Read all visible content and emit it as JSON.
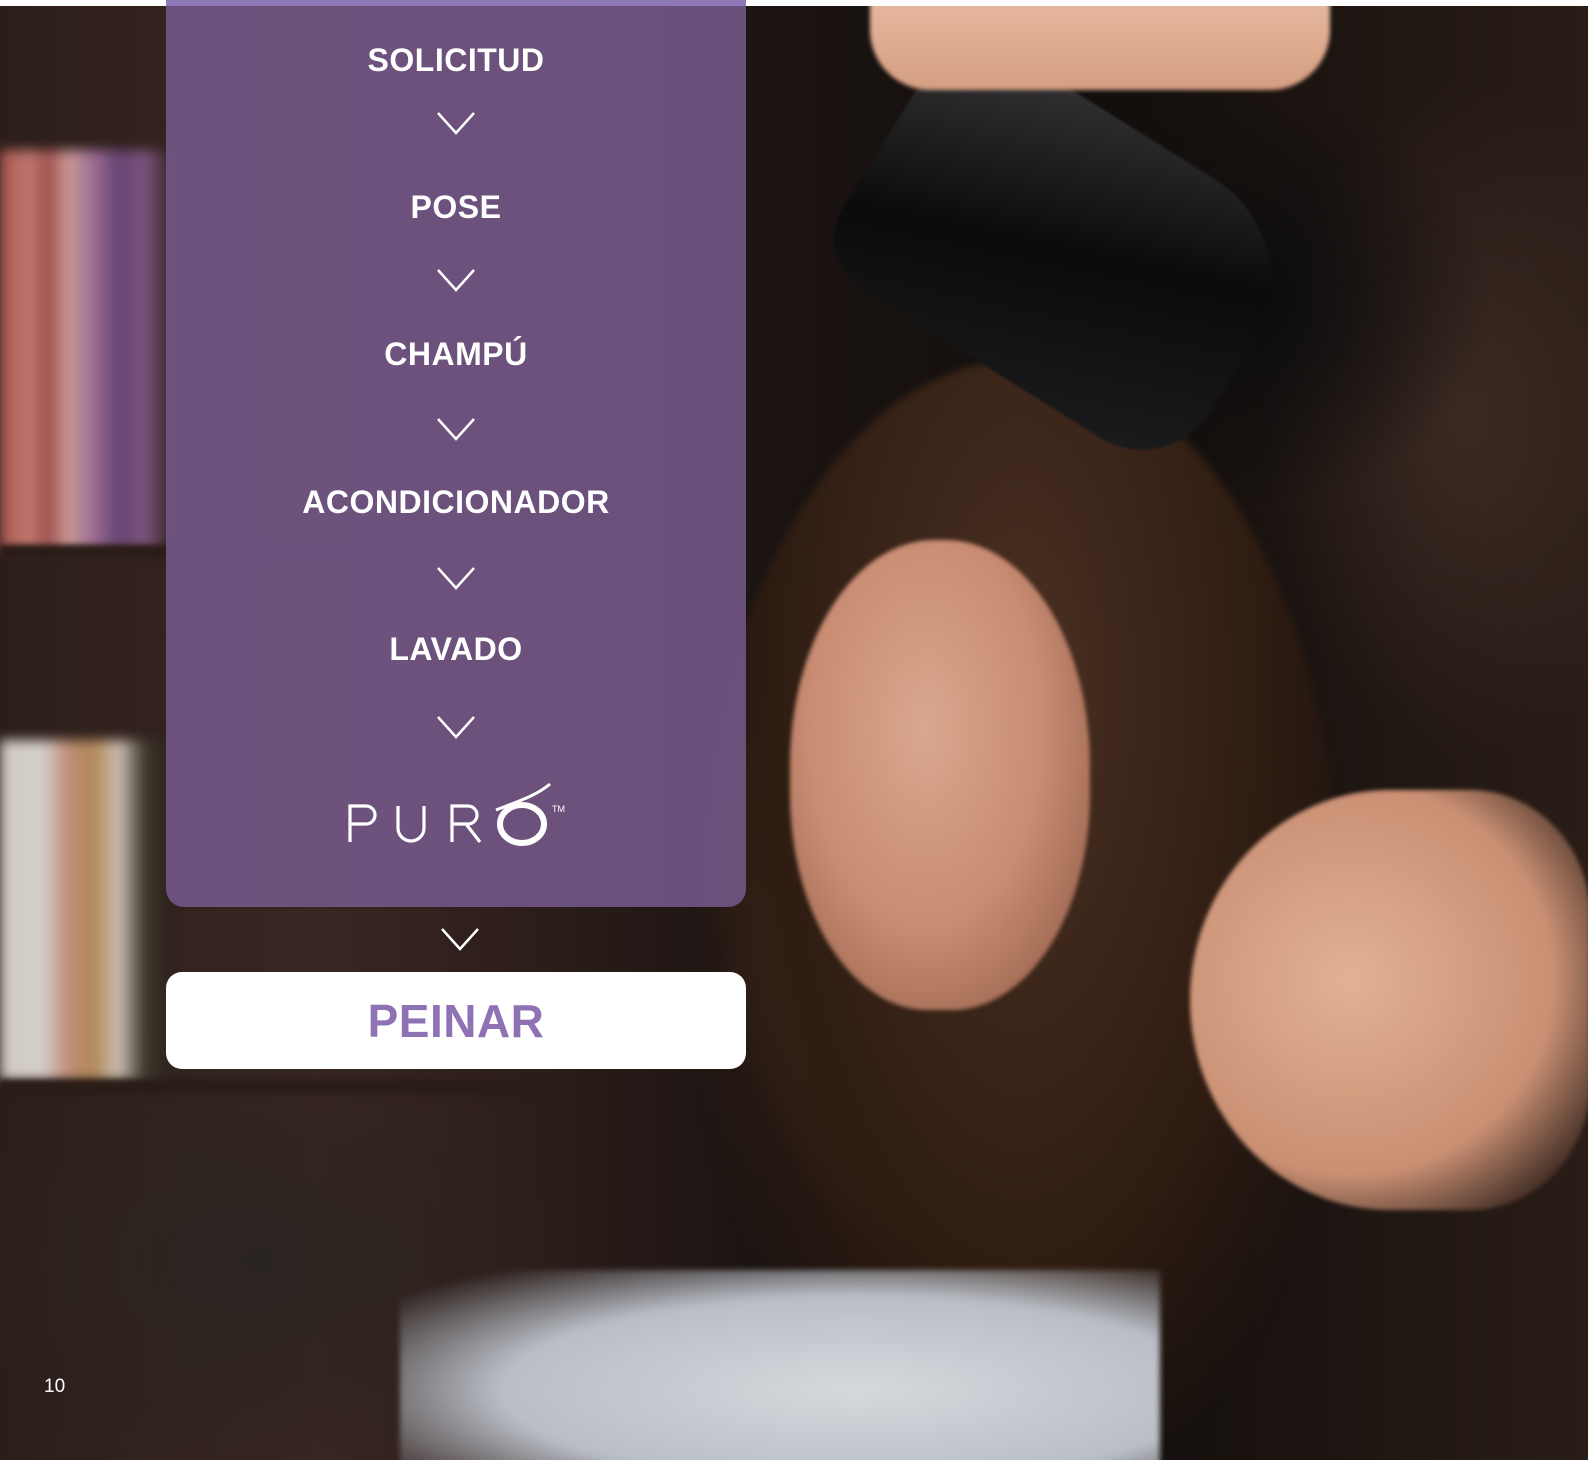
{
  "flow": {
    "steps": [
      {
        "label": "SOLICITUD"
      },
      {
        "label": "POSE"
      },
      {
        "label": "CHAMPÚ"
      },
      {
        "label": "ACONDICIONADOR"
      },
      {
        "label": "LAVADO"
      }
    ],
    "brand": {
      "name": "PURO",
      "trademark": "™"
    },
    "final_step": {
      "label": "PEINAR"
    }
  },
  "footer": {
    "page_number": "10"
  },
  "colors": {
    "panel_purple": "#765a8c",
    "panel_topbar": "#8f78b8",
    "final_label": "#8e72b4",
    "text_white": "#ffffff"
  },
  "icons": [
    "chevron-down-icon",
    "puro-logo"
  ]
}
